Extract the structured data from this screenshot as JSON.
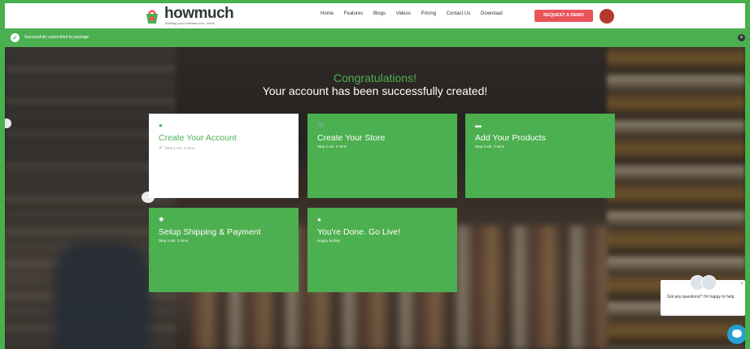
{
  "header": {
    "brand": "howmuch",
    "tagline": "Building your business one...small",
    "nav": [
      "Home",
      "Features",
      "Blogs",
      "Videos",
      "Pricing",
      "Contact Us",
      "Download"
    ],
    "cta": "REQUEST A DEMO"
  },
  "notice": {
    "text": "Successfully subscribed to package",
    "close": "×"
  },
  "hero": {
    "congrats": "Congratulations!",
    "message": "Your account has been successfully created!"
  },
  "steps": [
    {
      "title": "Create Your Account",
      "subtitle": "Step 1 est. 1 mins",
      "icon": "user-icon",
      "icon_glyph": "●",
      "status": "completed"
    },
    {
      "title": "Create Your Store",
      "subtitle": "Step 2 est. 2 mins",
      "icon": "cart-icon",
      "icon_glyph": "🛒"
    },
    {
      "title": "Add Your Products",
      "subtitle": "Step 3 est. 3 mins",
      "icon": "box-icon",
      "icon_glyph": "▬"
    },
    {
      "title": "Setup Shipping & Payment",
      "subtitle": "Step 4 est. 2 mins",
      "icon": "gear-icon",
      "icon_glyph": "✱"
    },
    {
      "title": "You're Done. Go Live!",
      "subtitle": "Happy Selling",
      "icon": "check-circle-icon",
      "icon_glyph": "●"
    }
  ],
  "chat": {
    "message": "Got any questions? I'm happy to help.",
    "close": "×"
  },
  "colors": {
    "brand_green": "#4caf50",
    "demo_red": "#e95459",
    "chat_blue": "#25a0d1"
  }
}
